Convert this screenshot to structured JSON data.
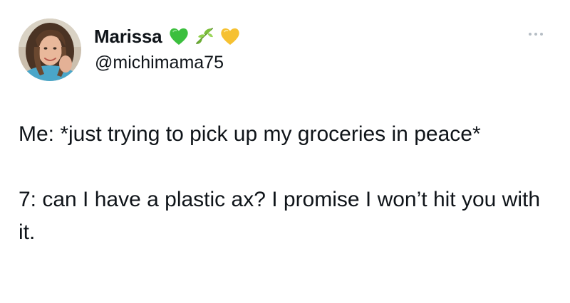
{
  "author": {
    "display_name": "Marissa",
    "handle": "@michimama75",
    "name_emojis": [
      "green-heart",
      "leaves",
      "yellow-heart"
    ]
  },
  "tweet": {
    "paragraphs": [
      "Me: *just trying to pick up my groceries in peace*",
      "7: can I have a plastic ax? I promise I won’t hit you with it."
    ]
  },
  "colors": {
    "text": "#0f1419",
    "more_dots": "#b6bec5",
    "green_heart": "#3bbf3e",
    "yellow_heart": "#f6c132",
    "leaf": "#7cbf3c"
  }
}
